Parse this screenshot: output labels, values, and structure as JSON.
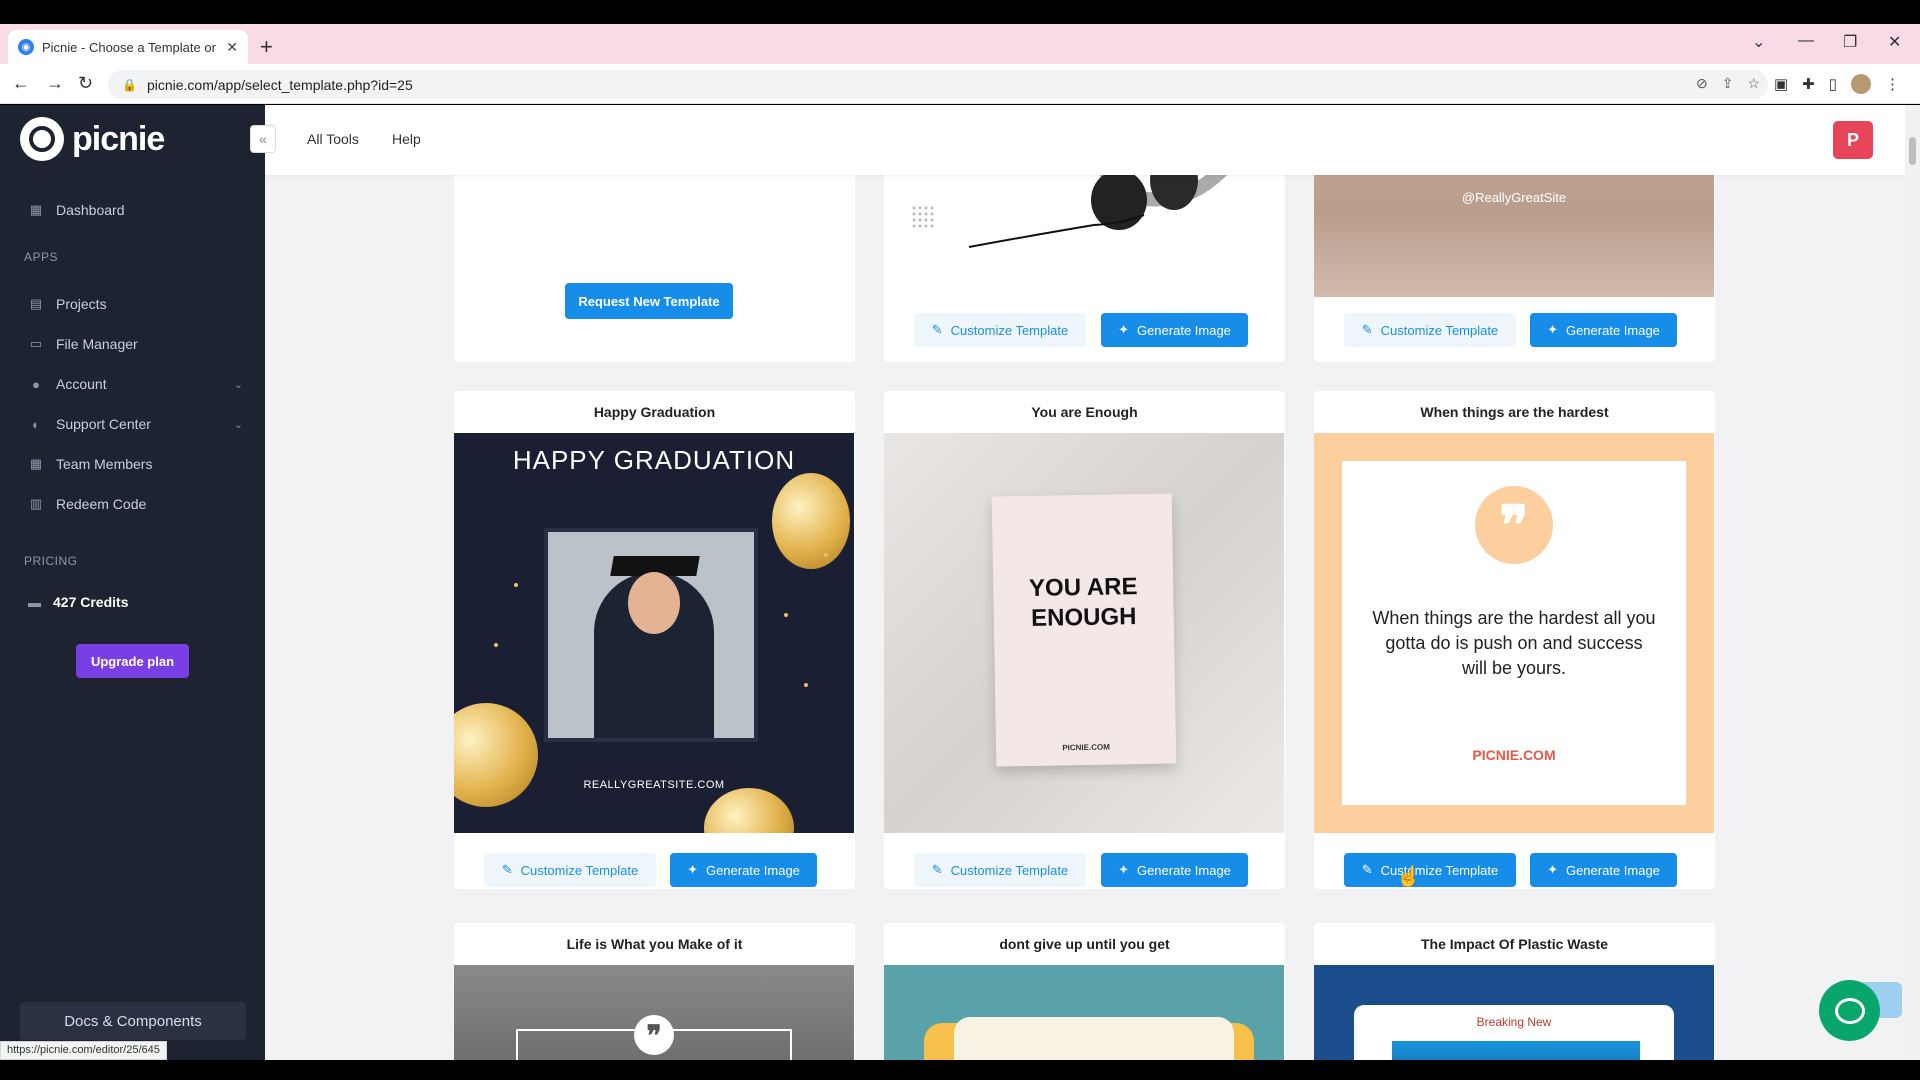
{
  "browser": {
    "tab_title": "Picnie - Choose a Template or Cr",
    "url": "picnie.com/app/select_template.php?id=25",
    "status_url": "https://picnie.com/editor/25/645"
  },
  "app": {
    "logo_text": "picnie",
    "nav": {
      "dashboard": "Dashboard",
      "apps_label": "APPS",
      "projects": "Projects",
      "file_manager": "File Manager",
      "account": "Account",
      "support_center": "Support Center",
      "team_members": "Team Members",
      "redeem_code": "Redeem Code",
      "pricing_label": "PRICING",
      "credits": "427 Credits",
      "upgrade": "Upgrade plan",
      "docs": "Docs & Components"
    },
    "topbar": {
      "all_tools": "All Tools",
      "help": "Help",
      "avatar_letter": "P"
    },
    "buttons": {
      "customize": "Customize Template",
      "generate": "Generate Image",
      "request": "Request New Template"
    },
    "beach": {
      "handle": "@ReallyGreatSite"
    },
    "cards": [
      {
        "title": "Happy Graduation",
        "heading": "HAPPY GRADUATION",
        "site": "REALLYGREATSITE.COM"
      },
      {
        "title": "You are Enough",
        "heading": "YOU ARE ENOUGH",
        "site": "PICNIE.COM"
      },
      {
        "title": "When things are the hardest",
        "quote": "When things are the hardest all you gotta do is push on and success will be yours.",
        "site": "PICNIE.COM"
      },
      {
        "title": "Life is What you Make of it"
      },
      {
        "title": "dont give up until you get"
      },
      {
        "title": "The Impact Of Plastic Waste",
        "label": "Breaking New"
      }
    ],
    "colors": {
      "sidebar_bg": "#1d2331",
      "accent_blue": "#168de8",
      "upgrade_purple": "#7a3fe4",
      "avatar_red": "#e8445a",
      "chat_green": "#08a66b"
    }
  }
}
